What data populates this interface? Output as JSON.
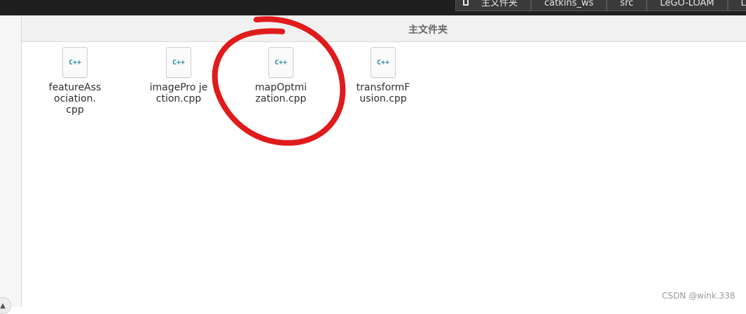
{
  "breadcrumbs": [
    {
      "label": "主文件夹",
      "icon": "home-folder-icon"
    },
    {
      "label": "catkins_ws"
    },
    {
      "label": "src"
    },
    {
      "label": "LeGO-LOAM"
    },
    {
      "label": "L"
    }
  ],
  "window_title": "主文件夹",
  "files": [
    {
      "icon_text": "C++",
      "name": "featureAss\nociation.\ncpp"
    },
    {
      "icon_text": "C++",
      "name": "imagePro je\nction.cpp"
    },
    {
      "icon_text": "C++",
      "name": "mapOptmi\nzation.cpp"
    },
    {
      "icon_text": "C++",
      "name": "transformF\nusion.cpp"
    }
  ],
  "annotation_color": "#e01b1b",
  "sidebar": {
    "scroll_up_glyph": "▲"
  },
  "watermark": "CSDN @wink.338"
}
